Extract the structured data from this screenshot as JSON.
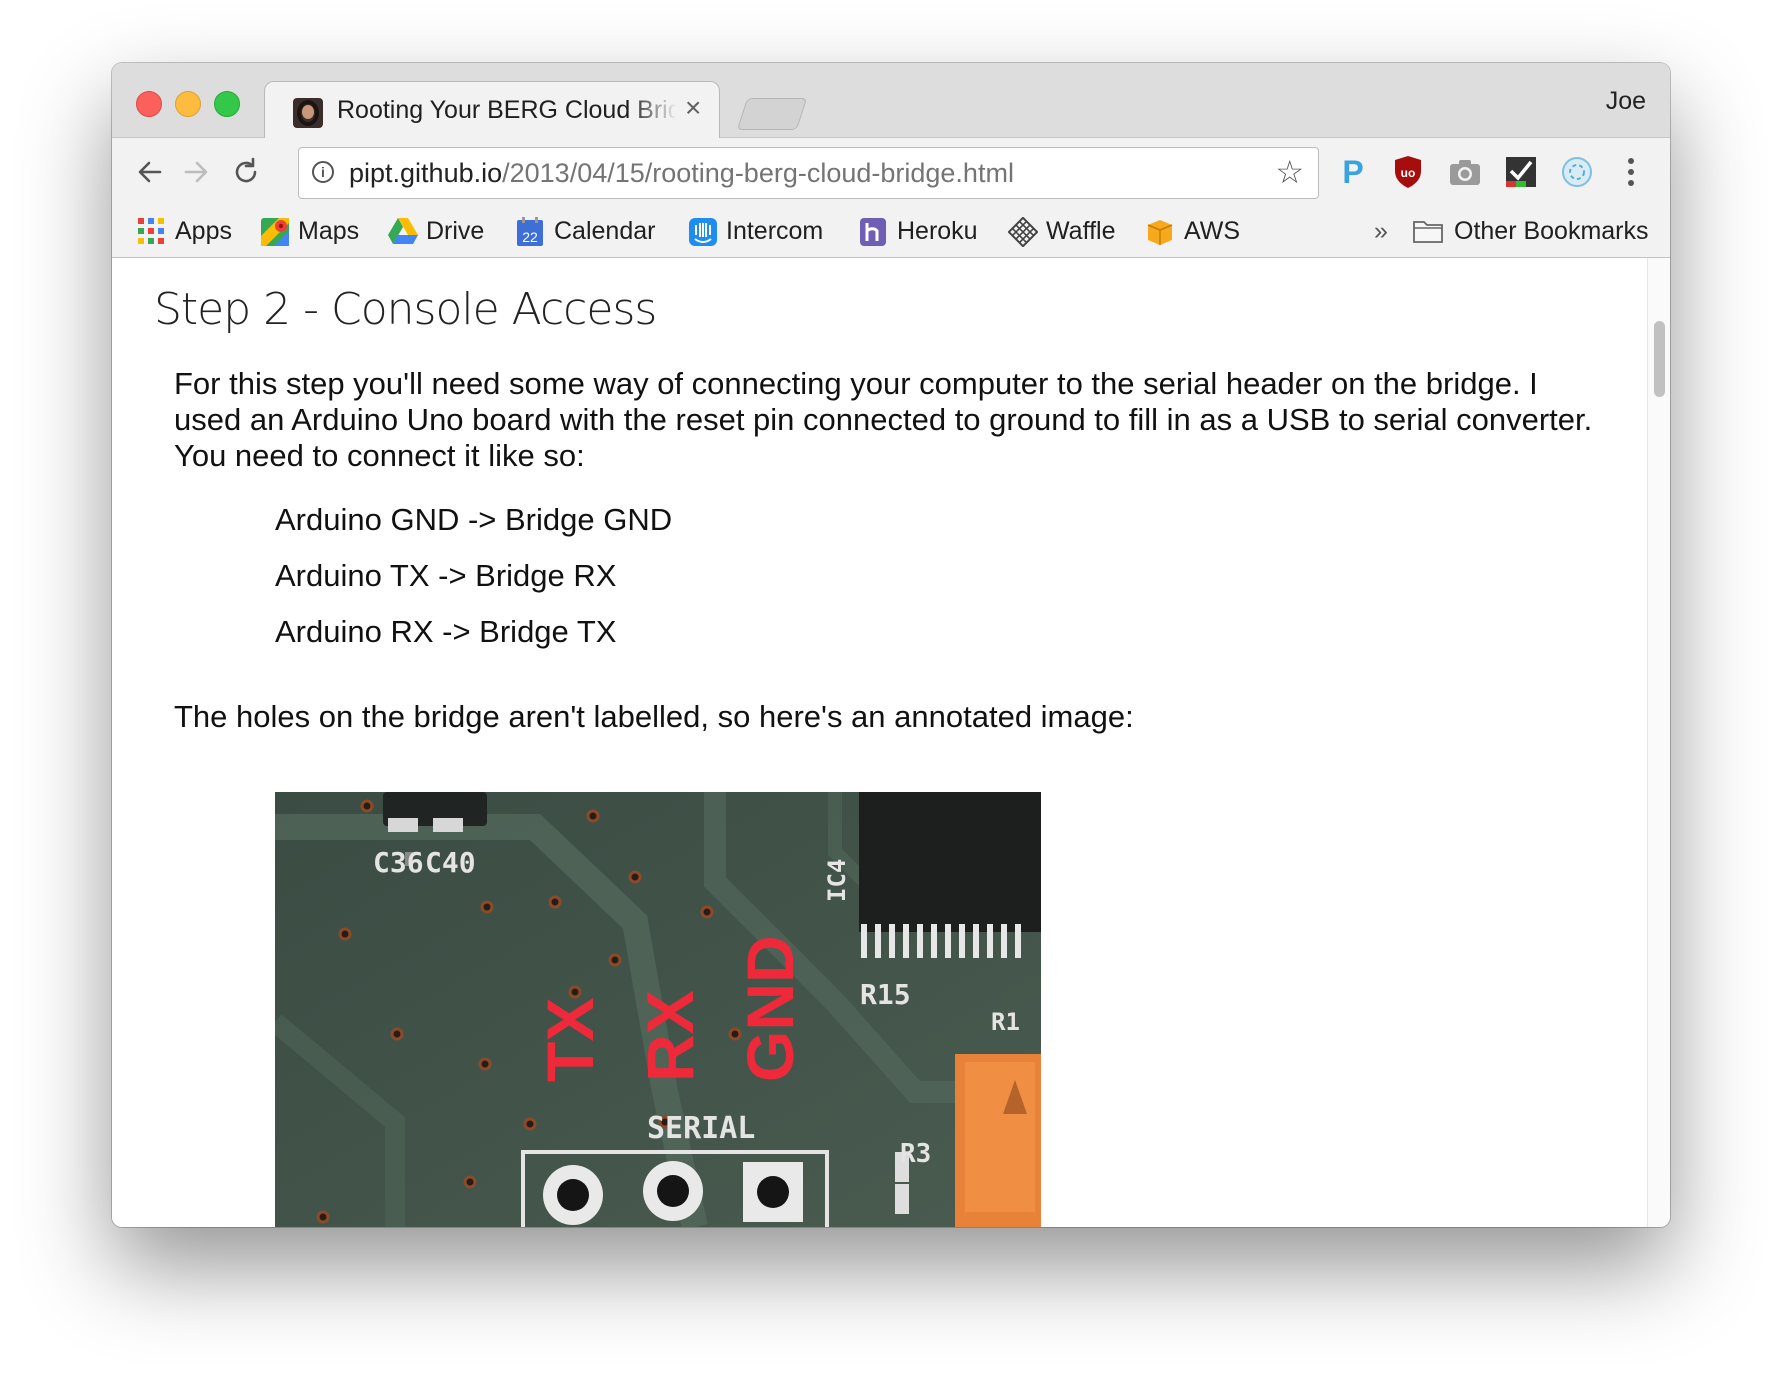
{
  "browser": {
    "tab": {
      "title": "Rooting Your BERG Cloud Bridge",
      "close_glyph": "×"
    },
    "profile_name": "Joe",
    "address": {
      "host": "pipt.github.io",
      "path": "/2013/04/15/rooting-berg-cloud-bridge.html"
    },
    "extensions": [
      "pocket-icon",
      "ublock-icon",
      "camera-icon",
      "checkmark-icon",
      "sync-icon"
    ]
  },
  "bookmarks": {
    "items": [
      {
        "label": "Apps",
        "icon": "apps-grid-icon"
      },
      {
        "label": "Maps",
        "icon": "maps-icon"
      },
      {
        "label": "Drive",
        "icon": "drive-icon"
      },
      {
        "label": "Calendar",
        "icon": "calendar-icon",
        "icon_text": "22"
      },
      {
        "label": "Intercom",
        "icon": "intercom-icon"
      },
      {
        "label": "Heroku",
        "icon": "heroku-icon"
      },
      {
        "label": "Waffle",
        "icon": "waffle-icon"
      },
      {
        "label": "AWS",
        "icon": "aws-icon"
      }
    ],
    "overflow": "»",
    "other": "Other Bookmarks"
  },
  "page": {
    "heading": "Step 2 - Console Access",
    "intro": "For this step you'll need some way of connecting your computer to the serial header on the bridge. I used an Arduino Uno board with the reset pin connected to ground to fill in as a USB to serial converter. You need to connect it like so:",
    "connections": [
      "Arduino GND -> Bridge GND",
      "Arduino TX -> Bridge RX",
      "Arduino RX -> Bridge TX"
    ],
    "holes_text": "The holes on the bridge aren't labelled, so here's an annotated image:",
    "image": {
      "labels": [
        "TX",
        "RX",
        "GND"
      ],
      "silkscreen": [
        "C36",
        "C40",
        "IC4",
        "R15",
        "R1",
        "SERIAL",
        "R3"
      ]
    }
  },
  "colors": {
    "annotation_red": "#ee2a3a",
    "pcb_green": "#3e5348",
    "chrome_bg": "#f2f2f2",
    "titlebar_bg": "#dddddd"
  }
}
